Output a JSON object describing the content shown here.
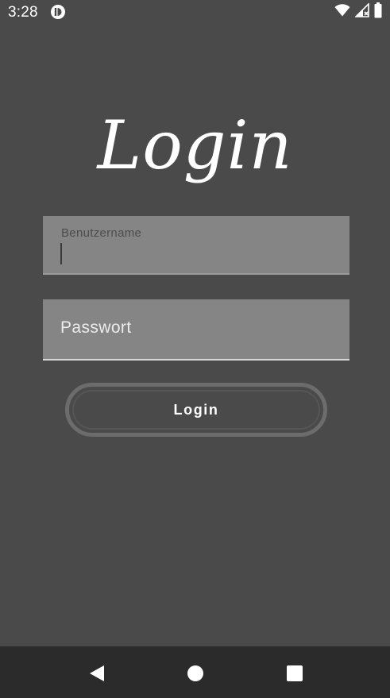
{
  "status_bar": {
    "time": "3:28",
    "icons": [
      "app-notification-icon",
      "wifi-icon",
      "cell-signal-icon",
      "battery-icon"
    ]
  },
  "login_form": {
    "title": "Login",
    "username": {
      "label": "Benutzername",
      "value": ""
    },
    "password": {
      "placeholder": "Passwort",
      "value": ""
    },
    "submit_label": "Login"
  },
  "navigation_bar": {
    "buttons": [
      "back-icon",
      "home-icon",
      "recents-icon"
    ]
  },
  "colors": {
    "background": "#4a4a4a",
    "field_background": "#858585",
    "button_border": "#6c6c6c",
    "nav_bar": "#2b2b2b",
    "text": "#ffffff"
  }
}
